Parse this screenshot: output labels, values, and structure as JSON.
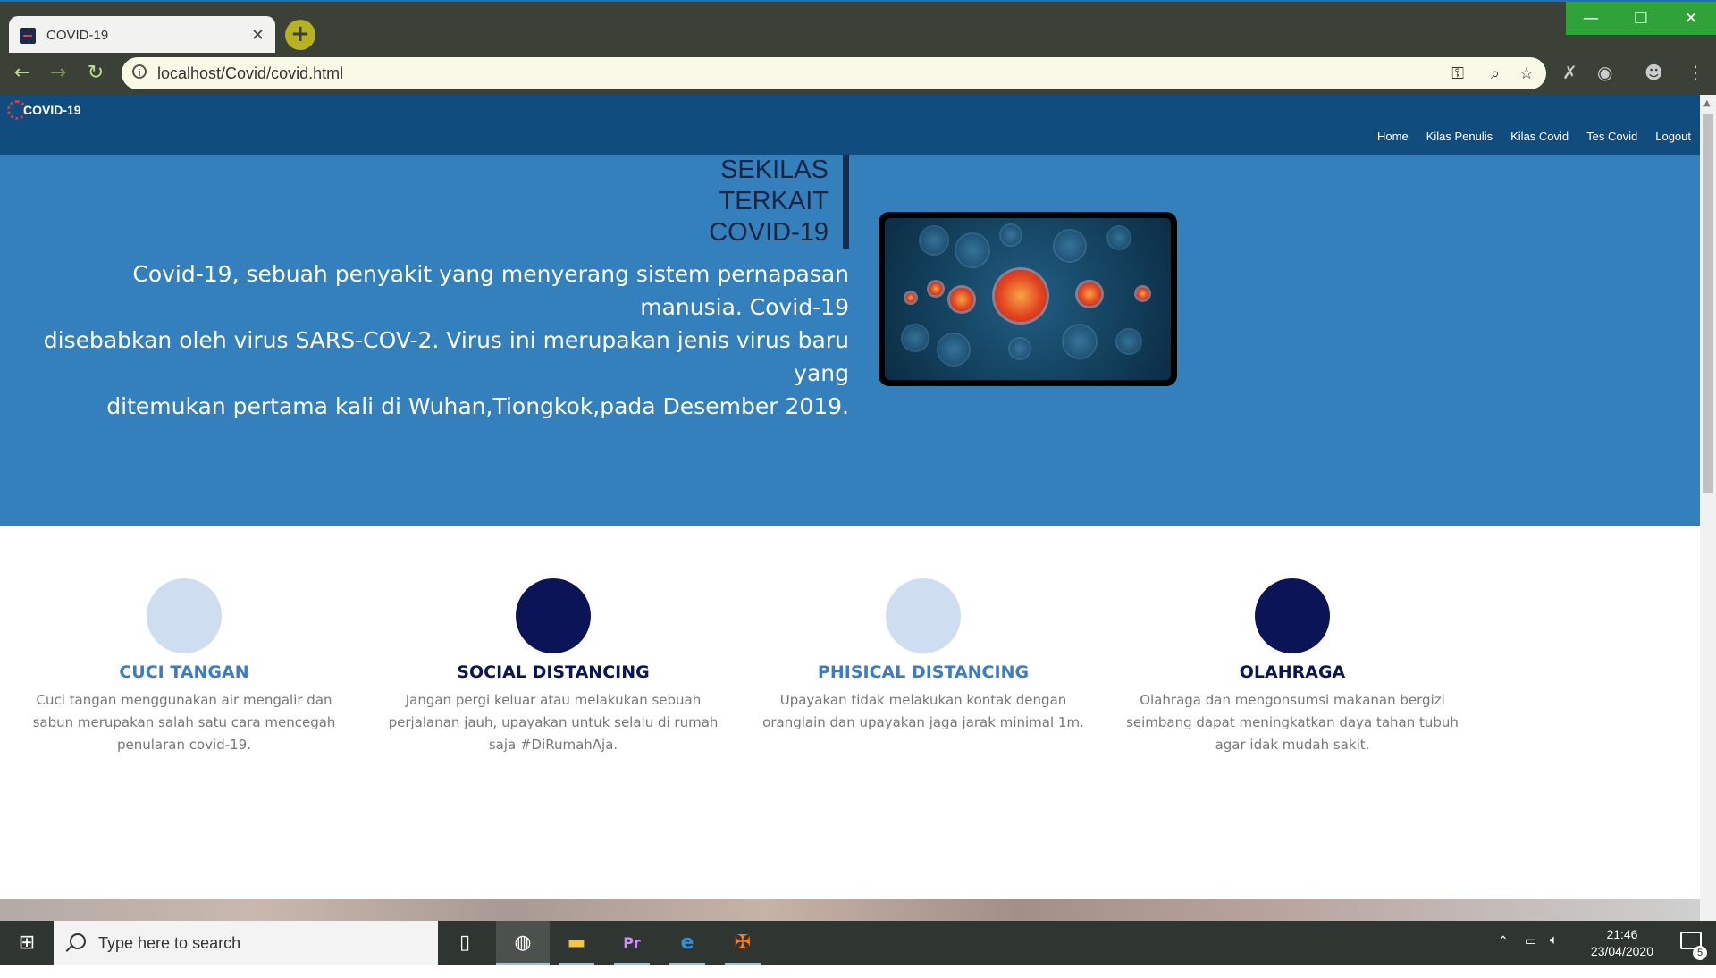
{
  "browser": {
    "tab_title": "COVID-19",
    "url": "localhost/Covid/covid.html"
  },
  "site": {
    "logo_text": "COVID-19",
    "nav": [
      {
        "label": "Home"
      },
      {
        "label": "Kilas Penulis"
      },
      {
        "label": "Kilas Covid"
      },
      {
        "label": "Tes Covid"
      },
      {
        "label": "Logout"
      }
    ]
  },
  "hero": {
    "heading_line1": "SEKILAS",
    "heading_line2": "TERKAIT",
    "heading_line3": "COVID-19",
    "line1": "Covid-19, sebuah penyakit yang menyerang sistem pernapasan manusia. Covid-19",
    "line2": "disebabkan oleh virus SARS-COV-2. Virus ini merupakan jenis virus baru yang",
    "line3": "ditemukan pertama kali di Wuhan,Tiongkok,pada Desember 2019."
  },
  "features": [
    {
      "title": "CUCI TANGAN",
      "desc": "Cuci tangan menggunakan air mengalir dan sabun merupakan salah satu cara mencegah penularan covid-19.",
      "circle_color": "#cfddf0",
      "title_color": "#3d7bc4"
    },
    {
      "title": "SOCIAL DISTANCING",
      "desc": "Jangan pergi keluar atau melakukan sebuah perjalanan jauh, upayakan untuk selalu di rumah saja #DiRumahAja.",
      "circle_color": "#0b1456",
      "title_color": "#0b1456"
    },
    {
      "title": "PHISICAL DISTANCING",
      "desc": "Upayakan tidak melakukan kontak dengan oranglain dan upayakan jaga jarak minimal 1m.",
      "circle_color": "#cfddf0",
      "title_color": "#3d7bc4"
    },
    {
      "title": "OLAHRAGA",
      "desc": "Olahraga dan mengonsumsi makanan bergizi seimbang dapat meningkatkan daya tahan tubuh agar idak mudah sakit.",
      "circle_color": "#0b1456",
      "title_color": "#0b1456"
    }
  ],
  "taskbar": {
    "search_placeholder": "Type here to search",
    "time": "21:46",
    "date": "23/04/2020",
    "notification_count": "5"
  },
  "colors": {
    "nav_bg": "#114c7f",
    "hero_bg": "#3380bc",
    "browser_chrome": "#3b4136",
    "window_controls": "#2fa33a"
  }
}
